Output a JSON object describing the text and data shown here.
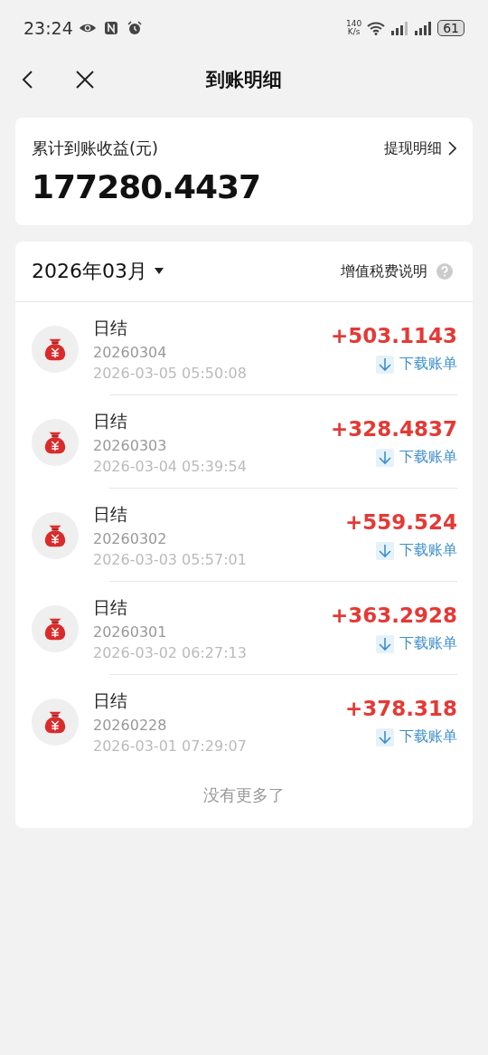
{
  "status_bar": {
    "time": "23:24",
    "net_speed": "140",
    "net_unit": "K/s",
    "battery": "61"
  },
  "nav": {
    "title": "到账明细"
  },
  "summary": {
    "label": "累计到账收益(元)",
    "link": "提现明细",
    "total": "177280.4437"
  },
  "list": {
    "month": "2026年03月",
    "tax_link": "增值税费说明",
    "items": [
      {
        "title": "日结",
        "batch": "20260304",
        "time": "2026-03-05 05:50:08",
        "amount": "+503.1143",
        "download": "下载账单"
      },
      {
        "title": "日结",
        "batch": "20260303",
        "time": "2026-03-04 05:39:54",
        "amount": "+328.4837",
        "download": "下载账单"
      },
      {
        "title": "日结",
        "batch": "20260302",
        "time": "2026-03-03 05:57:01",
        "amount": "+559.524",
        "download": "下载账单"
      },
      {
        "title": "日结",
        "batch": "20260301",
        "time": "2026-03-02 06:27:13",
        "amount": "+363.2928",
        "download": "下载账单"
      },
      {
        "title": "日结",
        "batch": "20260228",
        "time": "2026-03-01 07:29:07",
        "amount": "+378.318",
        "download": "下载账单"
      }
    ],
    "footer": "没有更多了"
  }
}
